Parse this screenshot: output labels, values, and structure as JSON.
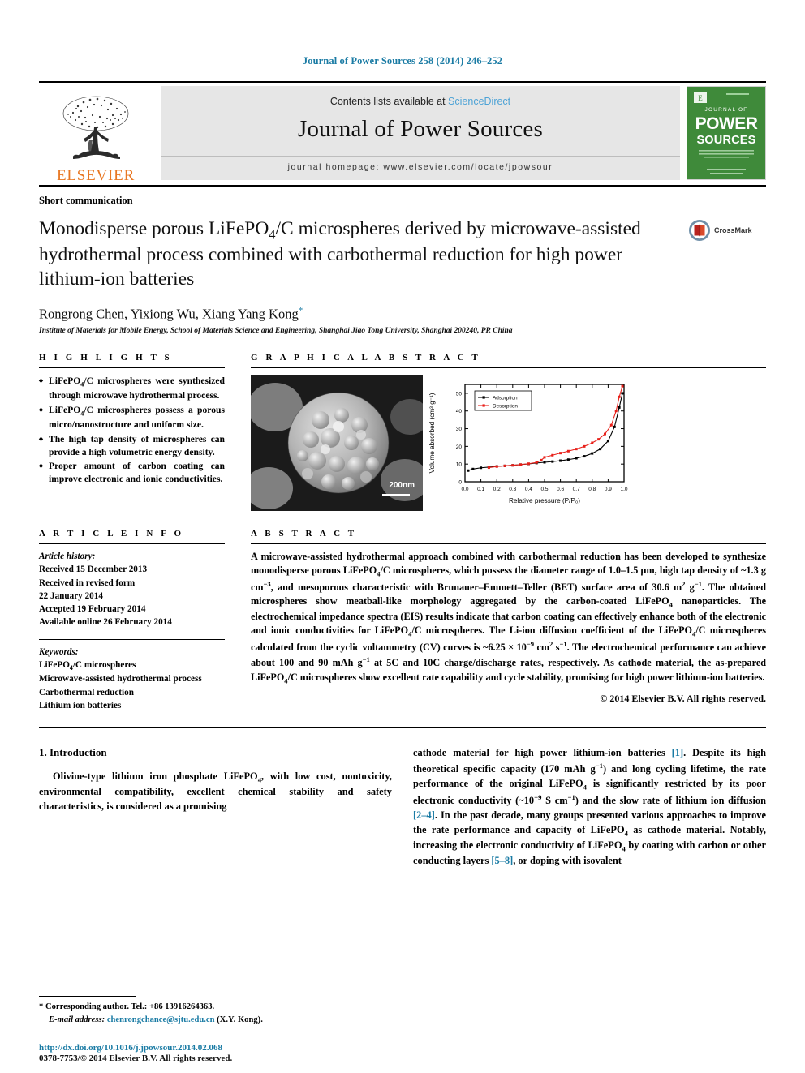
{
  "running_head": "Journal of Power Sources 258 (2014) 246–252",
  "masthead": {
    "publisher": "ELSEVIER",
    "contents_prefix": "Contents lists available at ",
    "contents_link": "ScienceDirect",
    "journal_name": "Journal of Power Sources",
    "homepage": "journal homepage: www.elsevier.com/locate/jpowsour",
    "cover": {
      "top_label": "JOURNAL OF",
      "title_line1": "POWER",
      "title_line2": "SOURCES",
      "background_color": "#3f8a3a"
    }
  },
  "article": {
    "type": "Short communication",
    "title": "Monodisperse porous LiFePO4/C microspheres derived by microwave-assisted hydrothermal process combined with carbothermal reduction for high power lithium-ion batteries",
    "crossmark_label": "CrossMark",
    "authors": "Rongrong Chen, Yixiong Wu, Xiang Yang Kong",
    "affiliation": "Institute of Materials for Mobile Energy, School of Materials Science and Engineering, Shanghai Jiao Tong University, Shanghai 200240, PR China"
  },
  "highlights": {
    "heading": "H I G H L I G H T S",
    "items": [
      "LiFePO4/C microspheres were synthesized through microwave hydrothermal process.",
      "LiFePO4/C microspheres possess a porous micro/nanostructure and uniform size.",
      "The high tap density of microspheres can provide a high volumetric energy density.",
      "Proper amount of carbon coating can improve electronic and ionic conductivities."
    ]
  },
  "graphical_abstract": {
    "heading": "G R A P H I C A L   A B S T R A C T",
    "sem_scalebar": "200nm"
  },
  "article_info": {
    "heading": "A R T I C L E   I N F O",
    "history_label": "Article history:",
    "history": [
      "Received 15 December 2013",
      "Received in revised form",
      "22 January 2014",
      "Accepted 19 February 2014",
      "Available online 26 February 2014"
    ],
    "keywords_label": "Keywords:",
    "keywords": [
      "LiFePO4/C microspheres",
      "Microwave-assisted hydrothermal process",
      "Carbothermal reduction",
      "Lithium ion batteries"
    ]
  },
  "abstract": {
    "heading": "A B S T R A C T",
    "text": "A microwave-assisted hydrothermal approach combined with carbothermal reduction has been developed to synthesize monodisperse porous LiFePO4/C microspheres, which possess the diameter range of 1.0–1.5 μm, high tap density of ~1.3 g cm−3, and mesoporous characteristic with Brunauer–Emmett–Teller (BET) surface area of 30.6 m2 g−1. The obtained microspheres show meatball-like morphology aggregated by the carbon-coated LiFePO4 nanoparticles. The electrochemical impedance spectra (EIS) results indicate that carbon coating can effectively enhance both of the electronic and ionic conductivities for LiFePO4/C microspheres. The Li-ion diffusion coefficient of the LiFePO4/C microspheres calculated from the cyclic voltammetry (CV) curves is ~6.25 × 10−9 cm2 s−1. The electrochemical performance can achieve about 100 and 90 mAh g−1 at 5C and 10C charge/discharge rates, respectively. As cathode material, the as-prepared LiFePO4/C microspheres show excellent rate capability and cycle stability, promising for high power lithium-ion batteries.",
    "copyright": "© 2014 Elsevier B.V. All rights reserved."
  },
  "body": {
    "section_heading": "1. Introduction",
    "left_paragraph": "Olivine-type lithium iron phosphate LiFePO4, with low cost, nontoxicity, environmental compatibility, excellent chemical stability and safety characteristics, is considered as a promising",
    "right_paragraph_parts": [
      "cathode material for high power lithium-ion batteries ",
      "[1]",
      ". Despite its high theoretical specific capacity (170 mAh g−1) and long cycling lifetime, the rate performance of the original LiFePO4 is significantly restricted by its poor electronic conductivity (~10−9 S cm−1) and the slow rate of lithium ion diffusion ",
      "[2–4]",
      ". In the past decade, many groups presented various approaches to improve the rate performance and capacity of LiFePO4 as cathode material. Notably, increasing the electronic conductivity of LiFePO4 by coating with carbon or other conducting layers ",
      "[5–8]",
      ", or doping with isovalent"
    ]
  },
  "footnote": {
    "corresponding": "* Corresponding author. Tel.: +86 13916264363.",
    "email_label": "E-mail address:",
    "email": "chenrongchance@sjtu.edu.cn",
    "email_suffix": "(X.Y. Kong).",
    "doi": "http://dx.doi.org/10.1016/j.jpowsour.2014.02.068",
    "issn": "0378-7753/© 2014 Elsevier B.V. All rights reserved."
  },
  "chart_data": {
    "type": "line",
    "title": "",
    "xlabel": "Relative pressure (P/P₀)",
    "ylabel": "Volume absorbed (cm³ g⁻¹)",
    "xlim": [
      0.0,
      1.0
    ],
    "ylim": [
      0,
      55
    ],
    "xticks": [
      "0.0",
      "0.1",
      "0.2",
      "0.3",
      "0.4",
      "0.5",
      "0.6",
      "0.7",
      "0.8",
      "0.9",
      "1.0"
    ],
    "yticks": [
      "0",
      "10",
      "20",
      "30",
      "40",
      "50"
    ],
    "grid": false,
    "legend_position": "top-left",
    "series": [
      {
        "name": "Adsorption",
        "color": "#000000",
        "marker": "square",
        "x": [
          0.02,
          0.05,
          0.1,
          0.15,
          0.2,
          0.25,
          0.3,
          0.35,
          0.4,
          0.45,
          0.5,
          0.55,
          0.6,
          0.65,
          0.7,
          0.75,
          0.8,
          0.85,
          0.9,
          0.94,
          0.97,
          0.99
        ],
        "y": [
          6.3,
          7.2,
          7.9,
          8.3,
          8.7,
          9.0,
          9.3,
          9.7,
          10.1,
          10.6,
          11.0,
          11.4,
          11.9,
          12.5,
          13.3,
          14.4,
          16.0,
          18.5,
          23.0,
          31.0,
          42.0,
          50.0
        ]
      },
      {
        "name": "Desorption",
        "color": "#e8201a",
        "marker": "square",
        "x": [
          0.99,
          0.97,
          0.95,
          0.92,
          0.88,
          0.84,
          0.8,
          0.75,
          0.7,
          0.65,
          0.6,
          0.55,
          0.5,
          0.48,
          0.45,
          0.4,
          0.35,
          0.3,
          0.25,
          0.2,
          0.15
        ],
        "y": [
          54.0,
          48.0,
          40.0,
          32.0,
          27.0,
          24.0,
          22.0,
          20.0,
          18.5,
          17.3,
          16.2,
          15.0,
          13.8,
          12.2,
          10.9,
          10.2,
          9.7,
          9.3,
          9.0,
          8.6,
          8.0
        ]
      }
    ]
  }
}
